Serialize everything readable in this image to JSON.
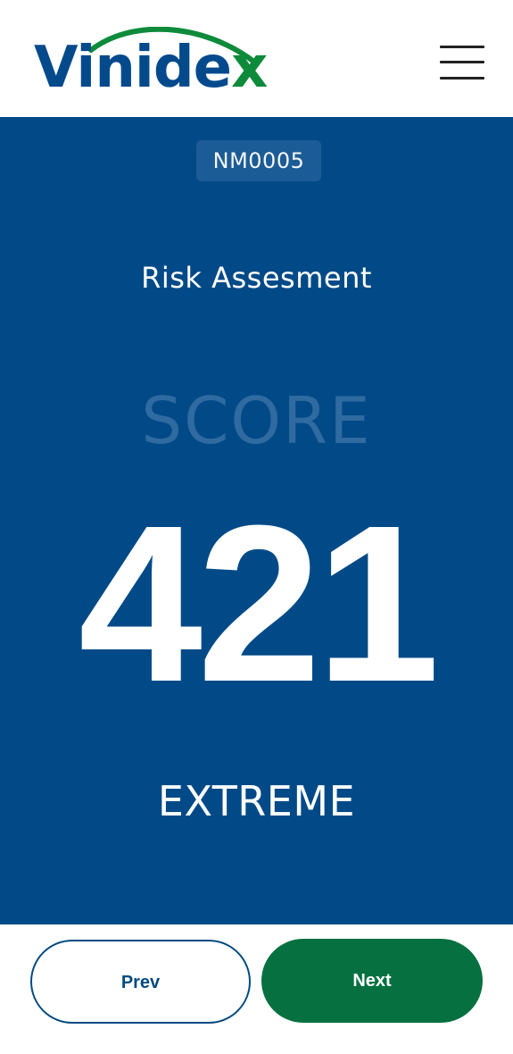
{
  "header": {
    "logo": {
      "text_main": "Vinide",
      "text_accent": "x",
      "brand_blue": "#034a8c",
      "brand_green": "#0e8a3b"
    },
    "menu_icon": "hamburger-menu-icon"
  },
  "assessment": {
    "code": "NM0005",
    "title": "Risk Assesment",
    "score_label": "SCORE",
    "score_value": "421",
    "level": "EXTREME",
    "panel_color": "#024a87"
  },
  "footer": {
    "prev_label": "Prev",
    "next_label": "Next",
    "next_color": "#067040"
  }
}
